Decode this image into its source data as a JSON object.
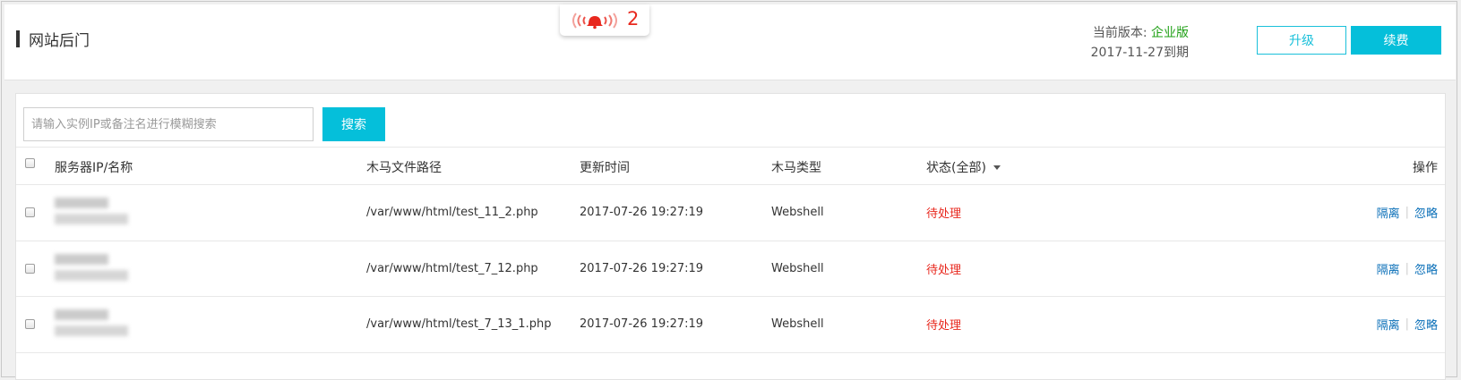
{
  "header": {
    "title": "网站后门",
    "alert_count": "2",
    "version_label": "当前版本:",
    "version_name": "企业版",
    "expire": "2017-11-27到期",
    "upgrade_label": "升级",
    "renew_label": "续费"
  },
  "search": {
    "placeholder": "请输入实例IP或备注名进行模糊搜索",
    "button_label": "搜索"
  },
  "table": {
    "columns": {
      "server": "服务器IP/名称",
      "path": "木马文件路径",
      "time": "更新时间",
      "type": "木马类型",
      "status": "状态(全部)",
      "ops": "操作"
    },
    "rows": [
      {
        "path": "/var/www/html/test_11_2.php",
        "time": "2017-07-26 19:27:19",
        "type": "Webshell",
        "status": "待处理",
        "op1": "隔离",
        "op2": "忽略"
      },
      {
        "path": "/var/www/html/test_7_12.php",
        "time": "2017-07-26 19:27:19",
        "type": "Webshell",
        "status": "待处理",
        "op1": "隔离",
        "op2": "忽略"
      },
      {
        "path": "/var/www/html/test_7_13_1.php",
        "time": "2017-07-26 19:27:19",
        "type": "Webshell",
        "status": "待处理",
        "op1": "隔离",
        "op2": "忽略"
      }
    ]
  },
  "colors": {
    "accent": "#05bfda",
    "alert": "#e8281e",
    "version": "#1fa015",
    "link": "#0a6fb8"
  }
}
